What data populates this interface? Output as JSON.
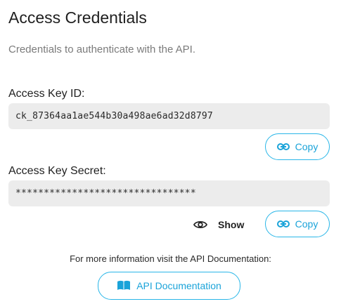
{
  "header": {
    "title": "Access Credentials",
    "subtitle": "Credentials to authenticate with the API."
  },
  "key_id": {
    "label": "Access Key ID:",
    "value": "ck_87364aa1ae544b30a498ae6ad32d8797",
    "copy_label": "Copy"
  },
  "key_secret": {
    "label": "Access Key Secret:",
    "value": "********************************",
    "show_label": "Show",
    "copy_label": "Copy"
  },
  "footer": {
    "info_text": "For more information visit the API Documentation:",
    "docs_button_label": "API Documentation"
  },
  "icons": {
    "copy": "link-icon",
    "show": "eye-icon",
    "docs": "book-icon"
  },
  "colors": {
    "accent": "#29b6e8",
    "field_bg": "#ececec"
  }
}
